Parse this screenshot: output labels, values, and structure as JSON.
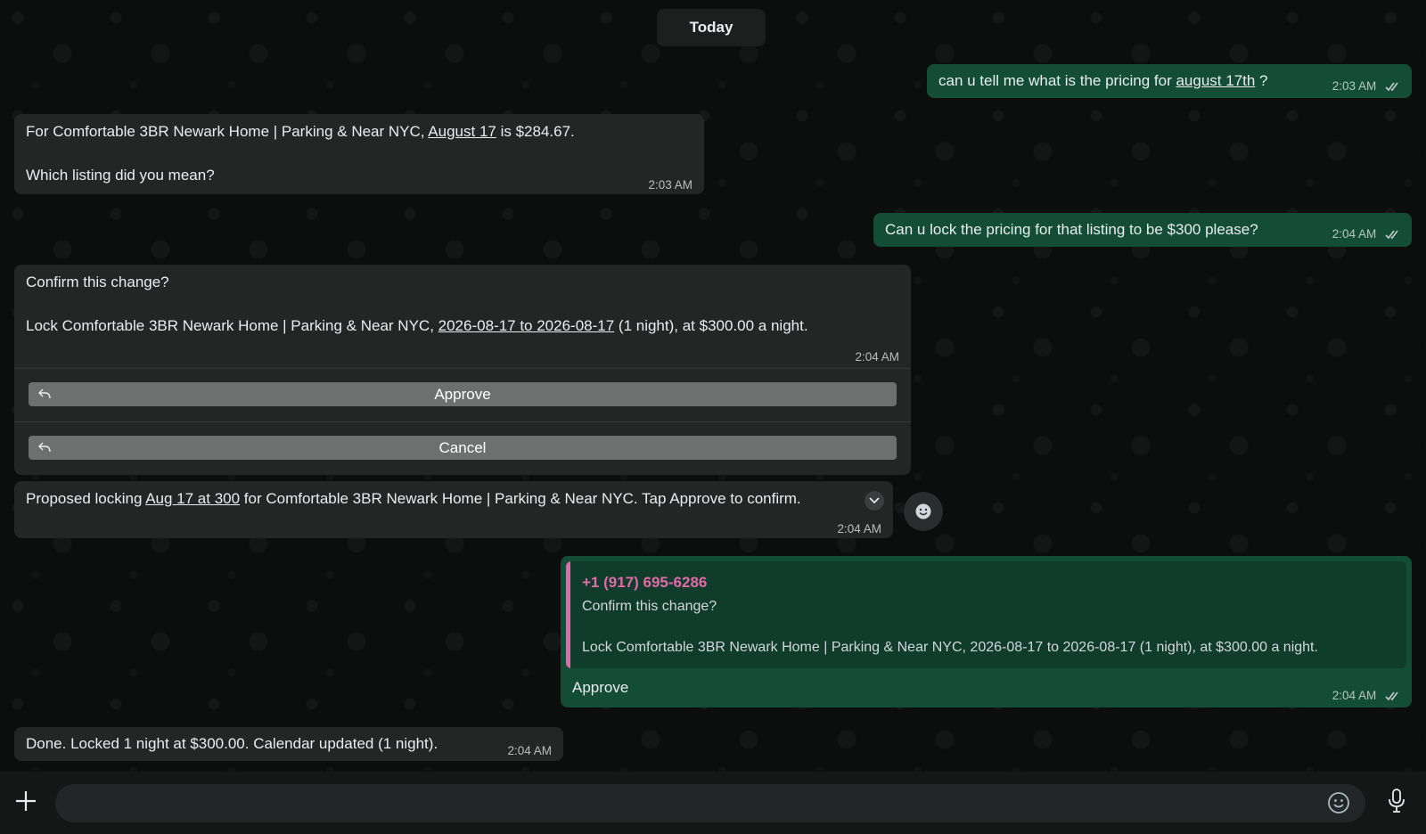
{
  "chat": {
    "date_label": "Today",
    "messages": {
      "m1": {
        "text_pre": "can u tell me what is the pricing for ",
        "link": "august 17th",
        "text_post": " ?",
        "time": "2:03 AM"
      },
      "m2": {
        "line1_pre": "For Comfortable 3BR Newark Home | Parking & Near NYC, ",
        "line1_link": "August 17",
        "line1_post": " is $284.67.",
        "line2": "Which listing did you mean?",
        "time": "2:03 AM"
      },
      "m3": {
        "text": "Can u lock the pricing for that listing to be $300 please?",
        "time": "2:04 AM"
      },
      "m4": {
        "line1": "Confirm this change?",
        "line2_pre": "Lock Comfortable 3BR Newark Home | Parking & Near NYC, ",
        "line2_link": "2026-08-17 to 2026-08-17",
        "line2_post": " (1 night), at $300.00 a night.",
        "time": "2:04 AM",
        "approve_label": "Approve",
        "cancel_label": "Cancel"
      },
      "m5": {
        "text_pre": "Proposed locking ",
        "link": "Aug 17 at 300",
        "text_post": " for Comfortable 3BR Newark Home | Parking & Near NYC. Tap Approve to confirm.",
        "time": "2:04 AM"
      },
      "m6": {
        "quote_author": "+1 (917) 695-6286",
        "quote_line1": "Confirm this change?",
        "quote_line2": "Lock Comfortable 3BR Newark Home | Parking & Near NYC, 2026-08-17 to 2026-08-17 (1 night), at $300.00 a night.",
        "text": "Approve",
        "time": "2:04 AM"
      },
      "m7": {
        "text": "Done. Locked 1 night at $300.00. Calendar updated (1 night).",
        "time": "2:04 AM"
      }
    }
  },
  "composer": {
    "value": "",
    "placeholder": ""
  },
  "colors": {
    "incoming": "#242626",
    "outgoing": "#144d37",
    "quote_accent": "#e26aa8",
    "background": "#0b0c0c"
  },
  "icons": [
    "plus-icon",
    "emoji-icon",
    "microphone-icon",
    "double-check-icon",
    "reply-icon",
    "chevron-down-icon",
    "reaction-emoji-icon"
  ]
}
